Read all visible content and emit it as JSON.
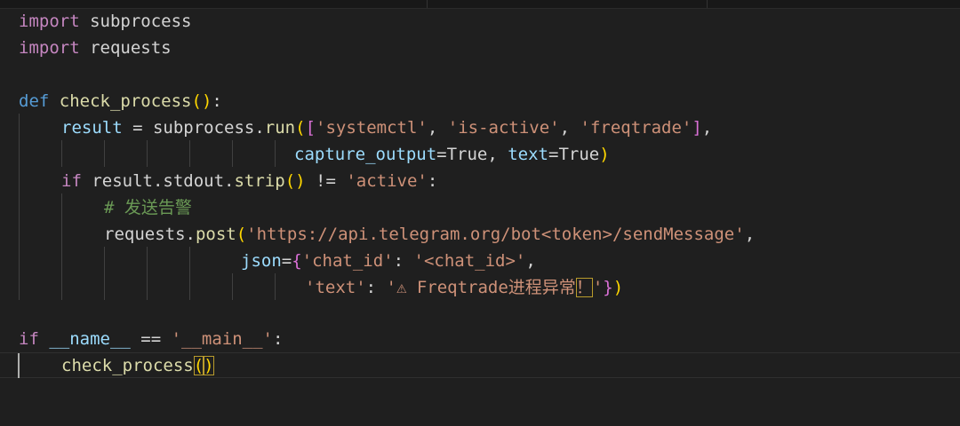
{
  "code": {
    "l1": {
      "kw": "import",
      "mod": " subprocess"
    },
    "l2": {
      "kw": "import",
      "mod": " requests"
    },
    "l4": {
      "kw": "def",
      "fn": " check_process",
      "open": "(",
      "close": ")",
      "colon": ":"
    },
    "l5": {
      "var": "result",
      "eq": " = subprocess.",
      "fn": "run",
      "p": "(",
      "b": "[",
      "s1": "'systemctl'",
      "c1": ", ",
      "s2": "'is-active'",
      "c2": ", ",
      "s3": "'freqtrade'",
      "bclose": "]",
      "tail": ","
    },
    "l6": {
      "arg1": "capture_output",
      "eq1": "=True, ",
      "arg2": "text",
      "eq2": "=True",
      "pclose": ")"
    },
    "l7": {
      "kw": "if",
      "mid": " result.stdout.",
      "fn": "strip",
      "p": "()",
      "op": " != ",
      "s": "'active'",
      "colon": ":"
    },
    "l8": {
      "comment": "# 发送告警"
    },
    "l9": {
      "obj": "requests.",
      "fn": "post",
      "p": "(",
      "s": "'https://api.telegram.org/bot<token>/sendMessage'",
      "tail": ","
    },
    "l10": {
      "arg": "json",
      "eq": "=",
      "brace": "{",
      "k": "'chat_id'",
      "colon": ": ",
      "v": "'<chat_id>'",
      "tail": ","
    },
    "l11": {
      "k": "'text'",
      "colon": ": ",
      "v1": "'⚠ Freqtrade进程异常",
      "v2": "！",
      "v3": "'",
      "brace": "}",
      "pclose": ")"
    },
    "l13": {
      "kw": "if",
      "var": " __name__",
      "op": " == ",
      "s": "'__main__'",
      "colon": ":"
    },
    "l14": {
      "fn": "check_process",
      "open": "(",
      "close": ")"
    }
  },
  "colors": {
    "background": "#1f1f1f",
    "keyword": "#c586c0",
    "function": "#dcdcaa",
    "variable": "#9cdcfe",
    "string": "#ce9178",
    "comment": "#6a9955"
  }
}
